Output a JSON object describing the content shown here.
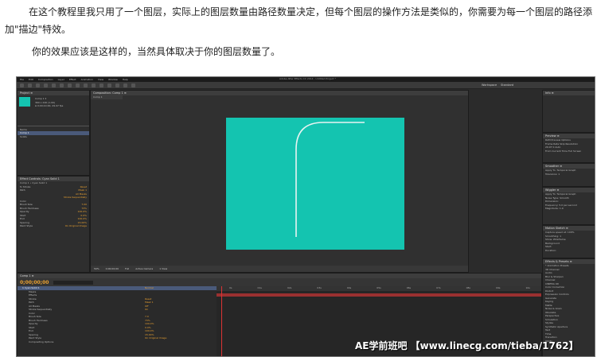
{
  "article": {
    "paragraph1": "在这个教程里我只用了一个图层，实际上的图层数量由路径数量决定，但每个图层的操作方法是类似的，你需要为每一个图层的路径添加\"描边\"特效。",
    "paragraph2": "你的效果应该是这样的，当然具体取决于你的图层数量了。"
  },
  "app": {
    "title": "Adobe After Effects CC 2014 - Untitled Project *",
    "menu": [
      "File",
      "Edit",
      "Composition",
      "Layer",
      "Effect",
      "Animation",
      "View",
      "Window",
      "Help"
    ],
    "workspace_label": "Workspace",
    "workspace_value": "Standard"
  },
  "project_panel": {
    "header": "Project ≡",
    "comp_name": "Comp 1 ▾",
    "comp_info1": "360 x 240 (1.00)",
    "comp_info2": "Δ 0;00;10;00, 29.97 fps",
    "items": [
      "Name",
      "Comp 1",
      "Solids"
    ]
  },
  "effect_controls": {
    "header": "Effect Controls: Cyan Solid 1",
    "layer": "Comp 1 • Cyan Solid 1",
    "rows": [
      {
        "label": "fx Stroke",
        "value": "Reset"
      },
      {
        "label": "Path",
        "value": "Mask 1"
      },
      {
        "label": "",
        "value": "All Masks"
      },
      {
        "label": "",
        "value": "Stroke Sequentially"
      },
      {
        "label": "Color",
        "value": ""
      },
      {
        "label": "Brush Size",
        "value": "7.00"
      },
      {
        "label": "Brush Hardness",
        "value": "73%"
      },
      {
        "label": "Opacity",
        "value": "100.0%"
      },
      {
        "label": "Start",
        "value": "0.0%"
      },
      {
        "label": "End",
        "value": "100.0%"
      },
      {
        "label": "Spacing",
        "value": "15.00%"
      },
      {
        "label": "Paint Style",
        "value": "On Original Image"
      }
    ]
  },
  "viewer": {
    "tab": "Composition: Comp 1 ≡",
    "comp_tab": "Comp 1",
    "bar_items": [
      "50%",
      "0;00;00;00",
      "Full",
      "Active Camera",
      "1 View"
    ],
    "stroke_color": "#e8f4f2",
    "canvas_color": "#14c4b0"
  },
  "timeline": {
    "tab": "Comp 1 ≡",
    "timecode": "0;00;00;00",
    "layer_rows": [
      {
        "label": "1  Cyan Solid 1",
        "value": "Normal"
      },
      {
        "label": "Masks",
        "value": ""
      },
      {
        "label": "Effects",
        "value": ""
      },
      {
        "label": "Stroke",
        "value": "Reset"
      },
      {
        "label": "Path",
        "value": "Mask 1"
      },
      {
        "label": "All Masks",
        "value": "Off"
      },
      {
        "label": "Stroke Sequentially",
        "value": "On"
      },
      {
        "label": "Color",
        "value": ""
      },
      {
        "label": "Brush Size",
        "value": "7.0"
      },
      {
        "label": "Brush Hardness",
        "value": "73%"
      },
      {
        "label": "Opacity",
        "value": "100.0%"
      },
      {
        "label": "Start",
        "value": "0.0%"
      },
      {
        "label": "End",
        "value": "100.0%"
      },
      {
        "label": "Spacing",
        "value": "15.00%"
      },
      {
        "label": "Paint Style",
        "value": "On Original Image"
      },
      {
        "label": "Compositing Options",
        "value": ""
      }
    ],
    "ruler": [
      "0s",
      "01s",
      "02s",
      "03s",
      "04s",
      "05s",
      "06s",
      "07s",
      "08s",
      "09s",
      "10s"
    ]
  },
  "right_panels": {
    "info": "Info ≡",
    "preview": "Preview ≡",
    "preview_rows": [
      "RAM Preview Options",
      "Frame Rate  Skip  Resolution",
      "29.97   0   Auto",
      "From Current Time   Full Screen"
    ],
    "smoother": "Smoother ≡",
    "smoother_rows": [
      "Apply To: Temporal Graph",
      "Tolerance: 1"
    ],
    "wiggler": "Wiggler ≡",
    "wiggler_rows": [
      "Apply To: Temporal Graph",
      "Noise Type: Smooth",
      "Dimension:",
      "Frequency: 5.0  per second",
      "Magnitude: 1.0"
    ],
    "motion_sketch": "Motion Sketch ≡",
    "motion_rows": [
      "Capture speed at: 100%",
      "Smoothing: 1",
      "Show: Wireframe",
      "Background",
      "Start:",
      "Duration:"
    ],
    "effects": "Effects & Presets ≡",
    "effects_rows": [
      "* Animation Presets",
      "3D Channel",
      "Audio",
      "Blur & Sharpen",
      "Channel",
      "CINEMA 4D",
      "Color Correction",
      "Distort",
      "Expression Controls",
      "Generate",
      "Keying",
      "Matte",
      "Noise & Grain",
      "Obsolete",
      "Perspective",
      "Simulation",
      "Stylize",
      "Synthetic Aperture",
      "Text",
      "Time",
      "Transition",
      "Utility"
    ]
  },
  "watermark": "AE学前班吧 【www.linecg.com/tieba/1762】"
}
